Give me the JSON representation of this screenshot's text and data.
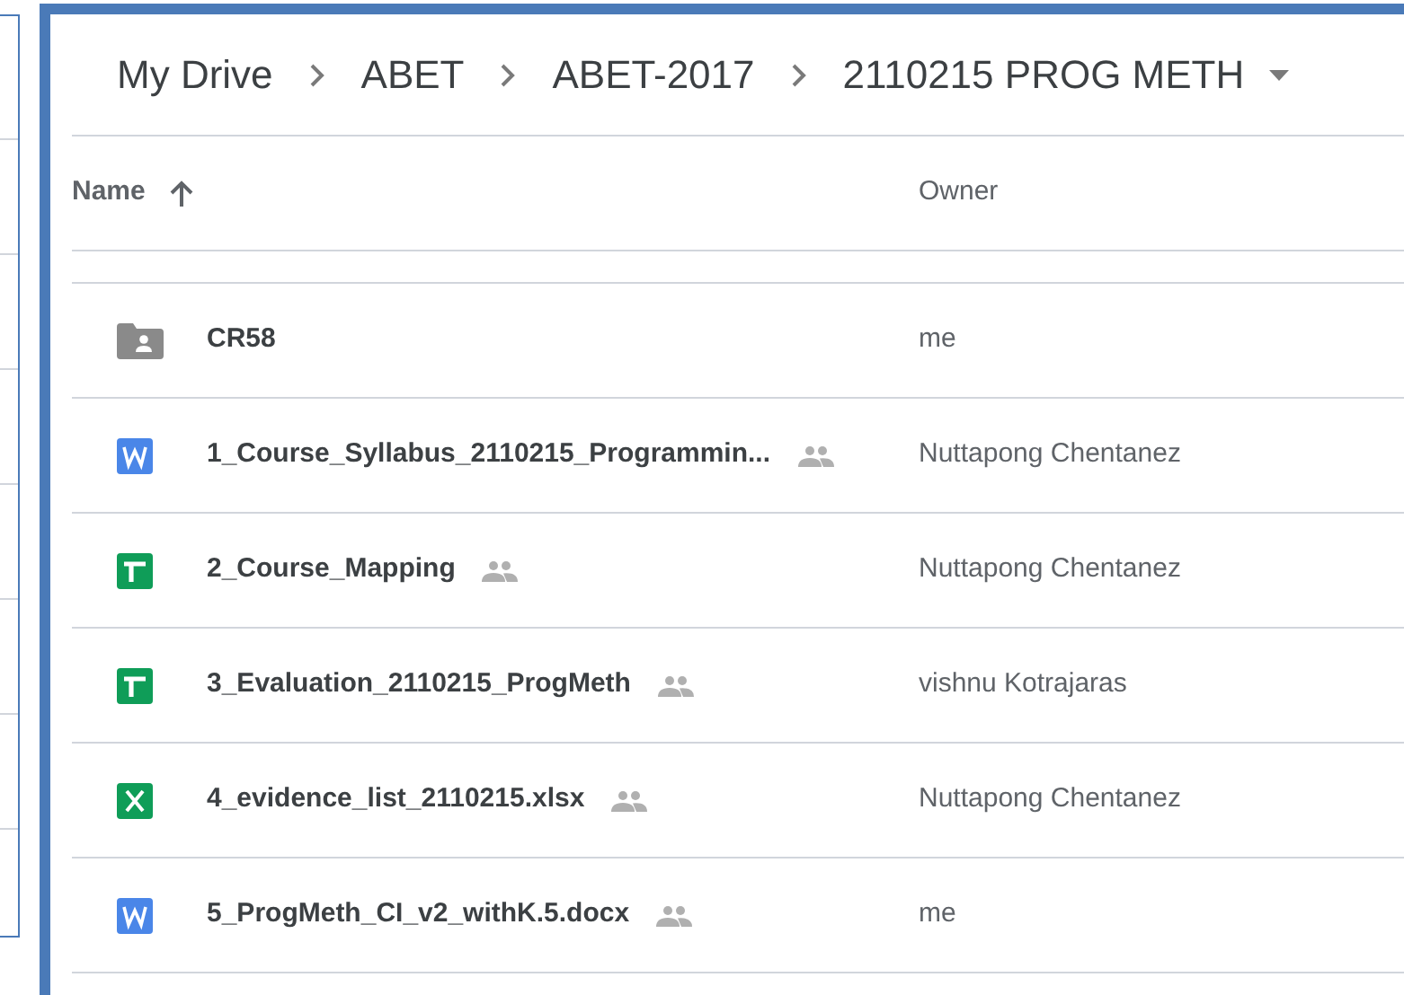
{
  "breadcrumb": [
    {
      "label": "My Drive"
    },
    {
      "label": "ABET"
    },
    {
      "label": "ABET-2017"
    },
    {
      "label": "2110215 PROG METH",
      "current": true
    }
  ],
  "table": {
    "columns": [
      {
        "label": "Name",
        "sort_ascending": true
      },
      {
        "label": "Owner"
      }
    ],
    "rows": [
      {
        "kind": "folder",
        "name": "CR58",
        "shared": false,
        "owner": "me"
      },
      {
        "kind": "word",
        "name": "1_Course_Syllabus_2110215_Programmin...",
        "shared": true,
        "owner": "Nuttapong Chentanez"
      },
      {
        "kind": "sheets",
        "name": "2_Course_Mapping",
        "shared": true,
        "owner": "Nuttapong Chentanez"
      },
      {
        "kind": "sheets",
        "name": "3_Evaluation_2110215_ProgMeth",
        "shared": true,
        "owner": "vishnu Kotrajaras"
      },
      {
        "kind": "excel",
        "name": "4_evidence_list_2110215.xlsx",
        "shared": true,
        "owner": "Nuttapong Chentanez"
      },
      {
        "kind": "word",
        "name": "5_ProgMeth_CI_v2_withK.5.docx",
        "shared": true,
        "owner": "me"
      }
    ]
  }
}
